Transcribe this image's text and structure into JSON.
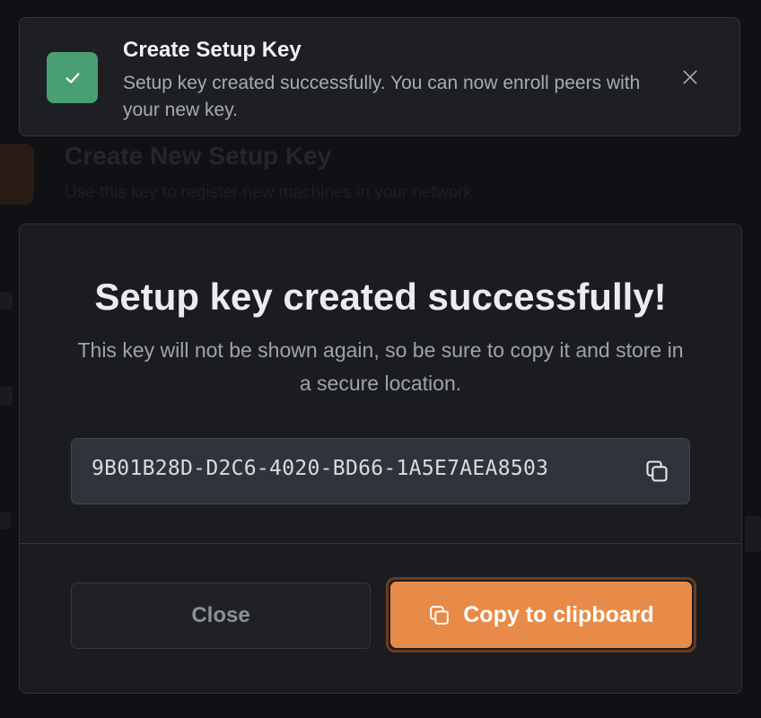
{
  "background": {
    "title": "Create New Setup Key",
    "subtitle": "Use this key to register new machines in your network"
  },
  "toast": {
    "title": "Create Setup Key",
    "message": "Setup key created successfully. You can now enroll peers with your new key.",
    "icon": "check-icon",
    "close_icon": "close-icon"
  },
  "modal": {
    "title": "Setup key created successfully!",
    "description": "This key will not be shown again, so be sure to copy it and store in a secure location.",
    "setup_key": "9B01B28D-D2C6-4020-BD66-1A5E7AEA8503",
    "close_label": "Close",
    "copy_label": "Copy to clipboard"
  },
  "colors": {
    "accent": "#e88b48",
    "success": "#4a9e73",
    "surface": "#1b1c20"
  }
}
